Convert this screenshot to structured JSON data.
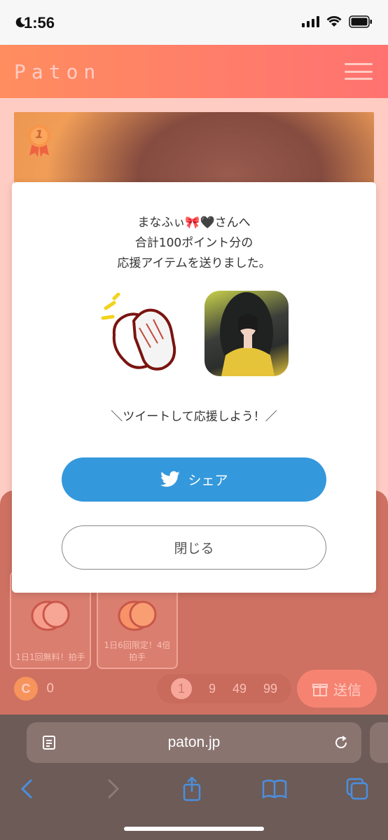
{
  "status_bar": {
    "time": "1:56"
  },
  "app": {
    "brand": "Paton"
  },
  "items": [
    {
      "label": "1日1回無料！拍手"
    },
    {
      "label": "1日6回限定！4倍拍手"
    }
  ],
  "wallet": {
    "coin_symbol": "C",
    "balance": "0"
  },
  "amount_options": [
    "1",
    "9",
    "49",
    "99"
  ],
  "amount_selected": "1",
  "send": {
    "label": "送信"
  },
  "modal": {
    "line1": "まなふぃ🎀🖤さんへ",
    "line2": "合計100ポイント分の",
    "line3": "応援アイテムを送りました。",
    "cta": "＼ツイートして応援しよう！／",
    "share_label": "シェア",
    "close_label": "閉じる",
    "rank": "1"
  },
  "browser": {
    "url": "paton.jp"
  },
  "colors": {
    "share": "#3498dc",
    "header_from": "#ff9a5c",
    "header_to": "#ff6f78"
  }
}
